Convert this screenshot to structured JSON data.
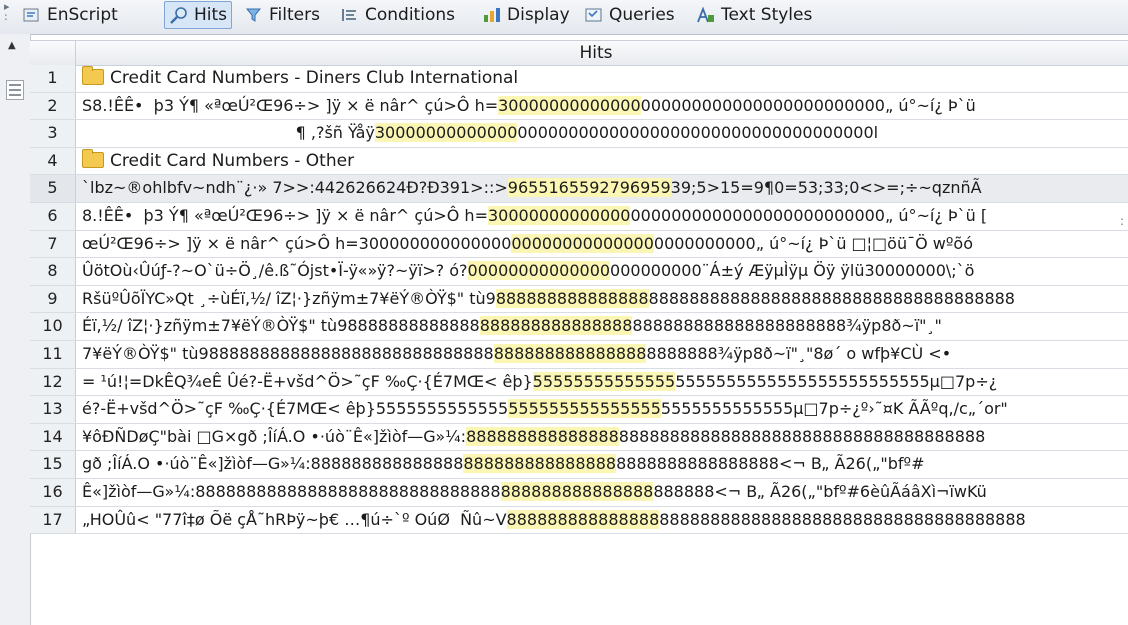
{
  "toolbar": {
    "items": [
      {
        "label": "EnScript",
        "icon": "enscript-icon",
        "active": false
      },
      {
        "label": "Hits",
        "icon": "magnifier-icon",
        "active": true
      },
      {
        "label": "Filters",
        "icon": "filter-icon",
        "active": false
      },
      {
        "label": "Conditions",
        "icon": "conditions-icon",
        "active": false
      },
      {
        "label": "Display",
        "icon": "display-icon",
        "active": false
      },
      {
        "label": "Queries",
        "icon": "queries-icon",
        "active": false
      },
      {
        "label": "Text Styles",
        "icon": "text-styles-icon",
        "active": false
      }
    ]
  },
  "grid": {
    "column_header": "Hits",
    "rows": [
      {
        "num": "1",
        "folder": true,
        "pre": "Credit Card Numbers - Diners Club International",
        "hit": "",
        "post": ""
      },
      {
        "num": "2",
        "folder": false,
        "pre": "S8.!ÊÊ•  þ3 Ý¶ «ªœÚ²Œ96÷> ]ÿ × ë nâr^ çú>Ô h=",
        "hit": "30000000000000",
        "post": "000000000000000000000000„ ú°~í¿ Þ`ü"
      },
      {
        "num": "3",
        "folder": false,
        "pre": "                                          ¶ ,?šñ Ÿåÿ",
        "hit": "30000000000000",
        "post": "00000000000000000000000000000000000l"
      },
      {
        "num": "4",
        "folder": true,
        "pre": "Credit Card Numbers - Other",
        "hit": "",
        "post": ""
      },
      {
        "num": "5",
        "folder": false,
        "pre": "`lbz~®ohlbfv~ndh¨¿·» 7>>:442626624Ð?Ð391>::>",
        "hit": "9655165592796959",
        "post": "39;5>15=9¶0=53;33;0<>=;÷~qznñÃ"
      },
      {
        "num": "6",
        "folder": false,
        "pre": "8.!ÊÊ•  þ3 Ý¶ «ªœÚ²Œ96÷> ]ÿ × ë nâr^ çú>Ô h=",
        "hit": "30000000000000",
        "post": "0000000000000000000000000„ ú°~í¿ Þ`ü ["
      },
      {
        "num": "7",
        "folder": false,
        "pre": "œÚ²Œ96÷> ]ÿ × ë nâr^ çú>Ô h=300000000000000",
        "hit": "00000000000000",
        "post": "0000000000„ ú°~í¿ Þ`ü □¦□öü¯Ö wºõó"
      },
      {
        "num": "8",
        "folder": false,
        "pre": "ÛötOù‹Ûúƒ-?~O`ü÷Ö¸/ê.ß˜Ójst•Ï-ÿ«»ÿ?~ÿï>? ó?",
        "hit": "00000000000000",
        "post": "000000000¨Á±ý ÆÿµÌÿµ Öÿ ÿlü30000000\\;`ö"
      },
      {
        "num": "9",
        "folder": false,
        "pre": "RšüºÛõÏYC»Qt ¸÷ùÉï,½/ îZ¦·}zñÿm±7¥ëÝ®ÒŸ$\" tù9",
        "hit": "888888888888888",
        "post": "888888888888888888888888888888888888"
      },
      {
        "num": "10",
        "folder": false,
        "pre": "Éï,½/ îZ¦·}zñÿm±7¥ëÝ®ÒŸ$\" tù98888888888888",
        "hit": "888888888888888",
        "post": "888888888888888888888¾ÿp8ð~ï\"¸\""
      },
      {
        "num": "11",
        "folder": false,
        "pre": "7¥ëÝ®ÒŸ$\" tù98888888888888888888888888888",
        "hit": "888888888888888",
        "post": "8888888¾ÿp8ð~ï\"¸\"8ø´ o wfþ¥CÙ <•"
      },
      {
        "num": "12",
        "folder": false,
        "pre": "= ¹ú!¦=DkÊQ¾eÊ Ûé?-Ë+všd^Ö>˜çF ‰Ç·{É7MŒ< êþ}",
        "hit": "55555555555555",
        "post": "5555555555555555555555555µ□7p÷¿"
      },
      {
        "num": "13",
        "folder": false,
        "pre": "é?-Ë+všd^Ö>˜çF ‰Ç·{É7MŒ< êþ}5555555555555",
        "hit": "555555555555555",
        "post": "5555555555555µ□7p÷¿º›˜¤K ÃÃºq,/c„´or\""
      },
      {
        "num": "14",
        "folder": false,
        "pre": "¥ôÐÑDøÇ\"bài □G×gð ;ÎíÁ.O •·úò¨Ê«]žìòf—G»¼:",
        "hit": "888888888888888",
        "post": "888888888888888888888888888888888888"
      },
      {
        "num": "15",
        "folder": false,
        "pre": "gð ;ÎíÁ.O •·úò¨Ê«]žìòf—G»¼:888888888888888",
        "hit": "888888888888888",
        "post": "8888888888888888<¬  B„ Ã26(„\"bfº#"
      },
      {
        "num": "16",
        "folder": false,
        "pre": "Ê«]žìòf—G»¼:888888888888888888888888888888",
        "hit": "888888888888888",
        "post": "888888<¬  B„ Ã26(„\"bfº#6èûÃáâXì¬ïwKü"
      },
      {
        "num": "17",
        "folder": false,
        "pre": "„HOÛû< \"77î‡ø Õë çÅ˜hRÞÿ~þ€ …¶ú÷`º OúØ  Ñû~V",
        "hit": "888888888888888",
        "post": "888888888888888888888888888888888888"
      }
    ]
  },
  "colors": {
    "hit_highlight": "#fbf6b4",
    "folder": "#f3c94f",
    "active_tab": "#d7e6f7"
  }
}
